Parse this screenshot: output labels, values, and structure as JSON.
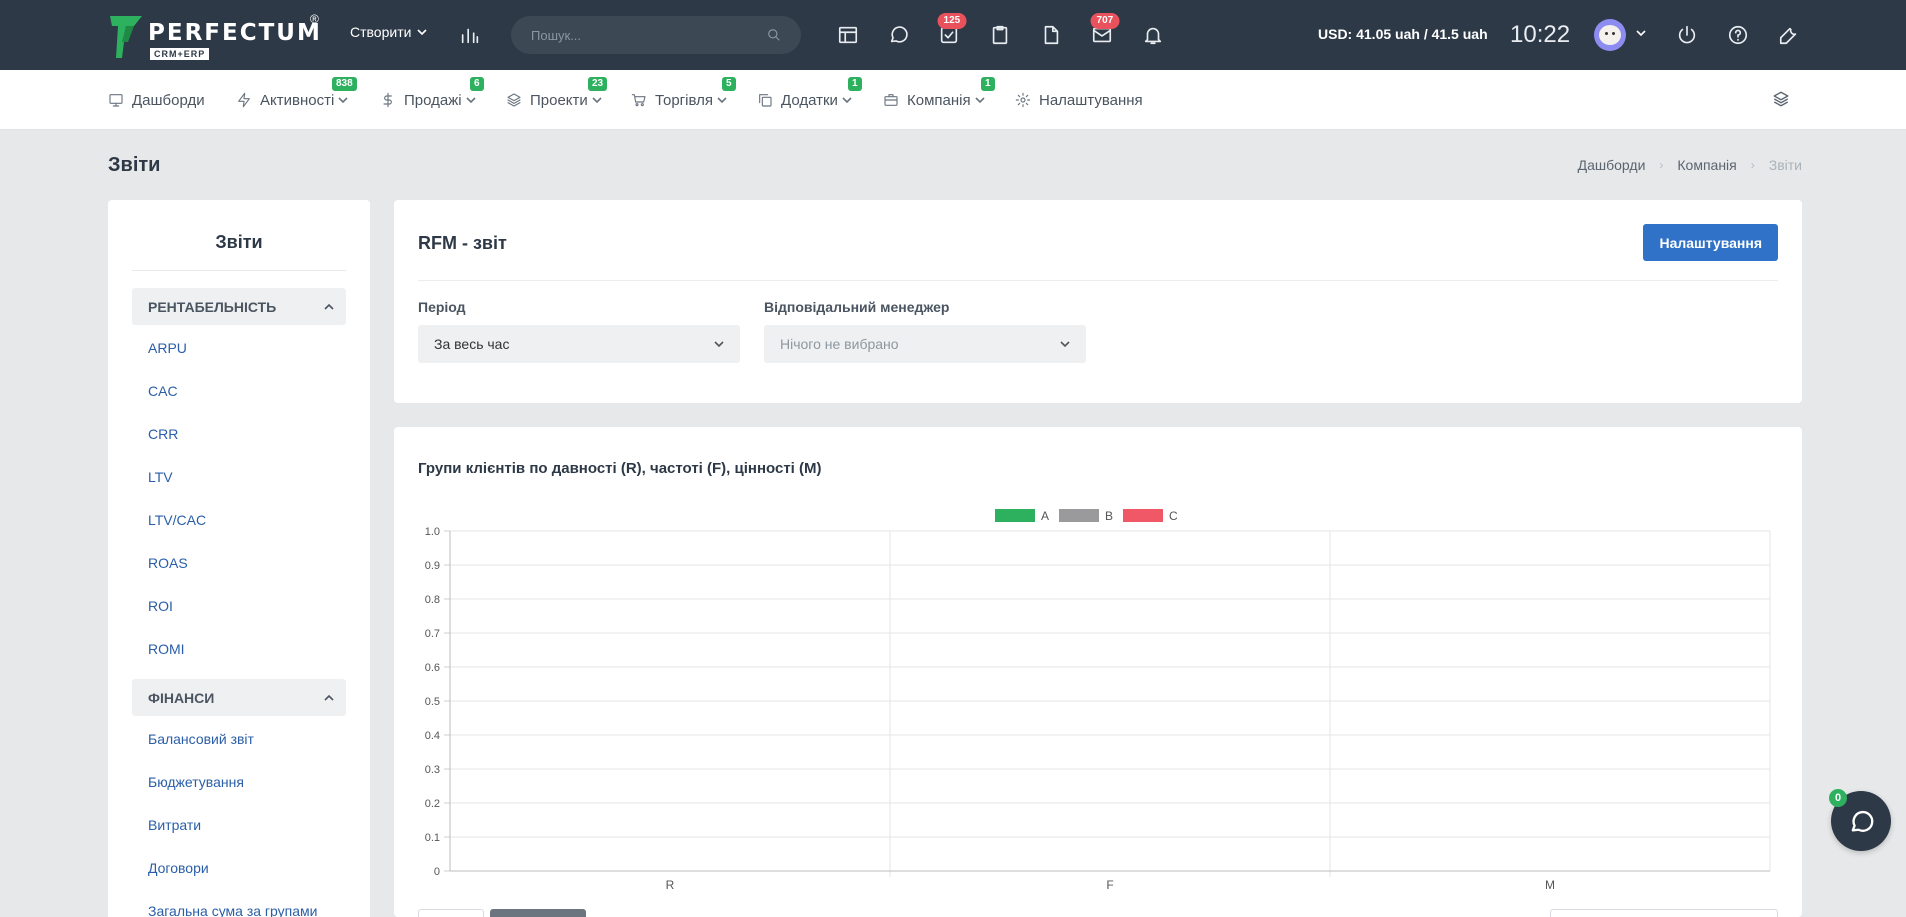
{
  "topbar": {
    "brand": "PERFECTUM",
    "brand_sub": "CRM+ERP",
    "create_label": "Створити",
    "search_placeholder": "Пошук...",
    "badges": {
      "tasks": "125",
      "mail": "707"
    },
    "currency": "USD: 41.05 uah / 41.5 uah",
    "time": "10:22"
  },
  "nav": {
    "items": [
      {
        "label": "Дашборди",
        "icon": "dashboard-icon"
      },
      {
        "label": "Активності",
        "badge": "838",
        "icon": "bolt-icon"
      },
      {
        "label": "Продажі",
        "badge": "6",
        "icon": "dollar-icon"
      },
      {
        "label": "Проекти",
        "badge": "23",
        "icon": "layers-icon"
      },
      {
        "label": "Торгівля",
        "badge": "5",
        "icon": "cart-icon"
      },
      {
        "label": "Додатки",
        "badge": "1",
        "icon": "copy-icon"
      },
      {
        "label": "Компанія",
        "badge": "1",
        "icon": "briefcase-icon"
      },
      {
        "label": "Налаштування",
        "icon": "gear-icon"
      }
    ]
  },
  "page": {
    "title": "Звіти",
    "breadcrumb": [
      "Дашборди",
      "Компанія",
      "Звіти"
    ]
  },
  "sidebar": {
    "title": "Звіти",
    "groups": [
      {
        "label": "РЕНТАБЕЛЬНІСТЬ",
        "items": [
          "ARPU",
          "CAC",
          "CRR",
          "LTV",
          "LTV/CAC",
          "ROAS",
          "ROI",
          "ROMI"
        ]
      },
      {
        "label": "ФІНАНСИ",
        "items": [
          "Балансовий звіт",
          "Бюджетування",
          "Витрати",
          "Договори",
          "Загальна сума за групами"
        ]
      }
    ]
  },
  "report": {
    "title": "RFM - звіт",
    "settings_button": "Налаштування",
    "period_label": "Період",
    "period_value": "За весь час",
    "manager_label": "Відповідальний менеджер",
    "manager_value": "Нічого не вибрано"
  },
  "chart_data": {
    "type": "bar",
    "title": "Групи клієнтів по давності (R), частоті (F), цінності (M)",
    "categories": [
      "R",
      "F",
      "M"
    ],
    "series": [
      {
        "name": "A",
        "color": "#2db15e",
        "values": [
          0,
          0,
          0
        ]
      },
      {
        "name": "B",
        "color": "#9a9a9c",
        "values": [
          0,
          0,
          0
        ]
      },
      {
        "name": "C",
        "color": "#f05868",
        "values": [
          0,
          0,
          0
        ]
      }
    ],
    "ylim": [
      0,
      1
    ],
    "yticks": [
      "0",
      "0.1",
      "0.2",
      "0.3",
      "0.4",
      "0.5",
      "0.6",
      "0.7",
      "0.8",
      "0.9",
      "1.0"
    ],
    "legend_position": "top-center",
    "grid": true
  },
  "chat": {
    "badge": "0"
  }
}
